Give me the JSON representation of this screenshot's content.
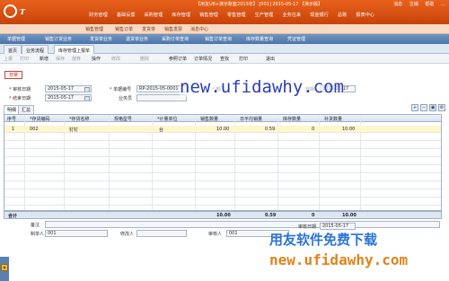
{
  "app": {
    "brand": "T",
    "top_info": "【用友U8+演示账套2015年】  [001]  2015-05-17  【演示版】",
    "right_links": [
      "消息",
      "注销",
      "帮助",
      "…"
    ],
    "menu": [
      "财务管理",
      "基础设置",
      "采购管理",
      "库存管理",
      "销售管理",
      "零售管理",
      "生产管理",
      "业务往来",
      "现金银行",
      "总账",
      "报表中心"
    ]
  },
  "nav2": [
    "销售管理",
    "销售订单",
    "发货单",
    "销售发票",
    "消息中心"
  ],
  "tabstrip": [
    "单据管理",
    "销售订货业务",
    "发货单业务",
    "退货单业务",
    "采购订单查询",
    "销售订单查询",
    "库存数量查询",
    "凭证管理"
  ],
  "doctabs": [
    {
      "label": "首页"
    },
    {
      "label": "业务流程"
    },
    {
      "label": "库存管理上报单",
      "active": true
    }
  ],
  "toolbar": [
    {
      "label": "上报",
      "disabled": true
    },
    {
      "label": "打印",
      "disabled": true
    },
    {
      "label": "新增"
    },
    {
      "label": "保存",
      "disabled": true
    },
    {
      "label": "放弃",
      "disabled": true
    },
    {
      "label": "操作"
    },
    {
      "label": "修改",
      "disabled": true
    },
    {
      "label": "删除",
      "disabled": true
    },
    {
      "label": "参照订单"
    },
    {
      "label": "订单情况"
    },
    {
      "label": "查找"
    },
    {
      "label": "打印"
    },
    {
      "label": "退出"
    }
  ],
  "title_box": "日常",
  "form": {
    "start_date_label": "审核日期",
    "start_date": "2015-05-17",
    "end_date_label": "结束日期",
    "end_date": "2015-05-17",
    "doc_no_label": "单据编号",
    "doc_no": "RP-2015-05-0001",
    "staff_label": "业务员",
    "staff": "",
    "dept_label": "部门",
    "dept": "",
    "date2_label": "日期",
    "date2": "2015-05-17"
  },
  "watermark": {
    "top": "new.ufidawhy.com",
    "cn": "用友软件免费下载",
    "bottom": "new.ufidawhy.com"
  },
  "grid": {
    "tabs": [
      "明细",
      "汇总"
    ],
    "icons": [
      "grid-add-icon",
      "grid-delete-icon",
      "grid-copy-icon",
      "grid-setting-icon"
    ],
    "headers": [
      "序号",
      "*存货编码",
      "*存货名称",
      "规格型号",
      "*计量单位",
      "销售数量",
      "日平均销量",
      "库存数量",
      "补货数量"
    ],
    "rows": [
      {
        "no": "1",
        "code": "002",
        "name": "钉钉",
        "spec": "",
        "unit": "台",
        "sales_qty": "10.00",
        "avg_sales": "0.59",
        "stock_qty": "0",
        "replenish_qty": "10.00"
      }
    ],
    "total_label": "合计",
    "total": {
      "sales_qty": "10.00",
      "avg_sales": "0.59",
      "stock_qty": "0",
      "replenish_qty": "10.00"
    }
  },
  "footer": {
    "remark_label": "备注",
    "remark": "",
    "maker_label": "制单人",
    "maker": "001",
    "modifier_label": "修改人",
    "modifier": "",
    "auditor_label": "审核人",
    "auditor": "001",
    "audit_date_label": "审核日期",
    "audit_date": "2015-05-17"
  }
}
